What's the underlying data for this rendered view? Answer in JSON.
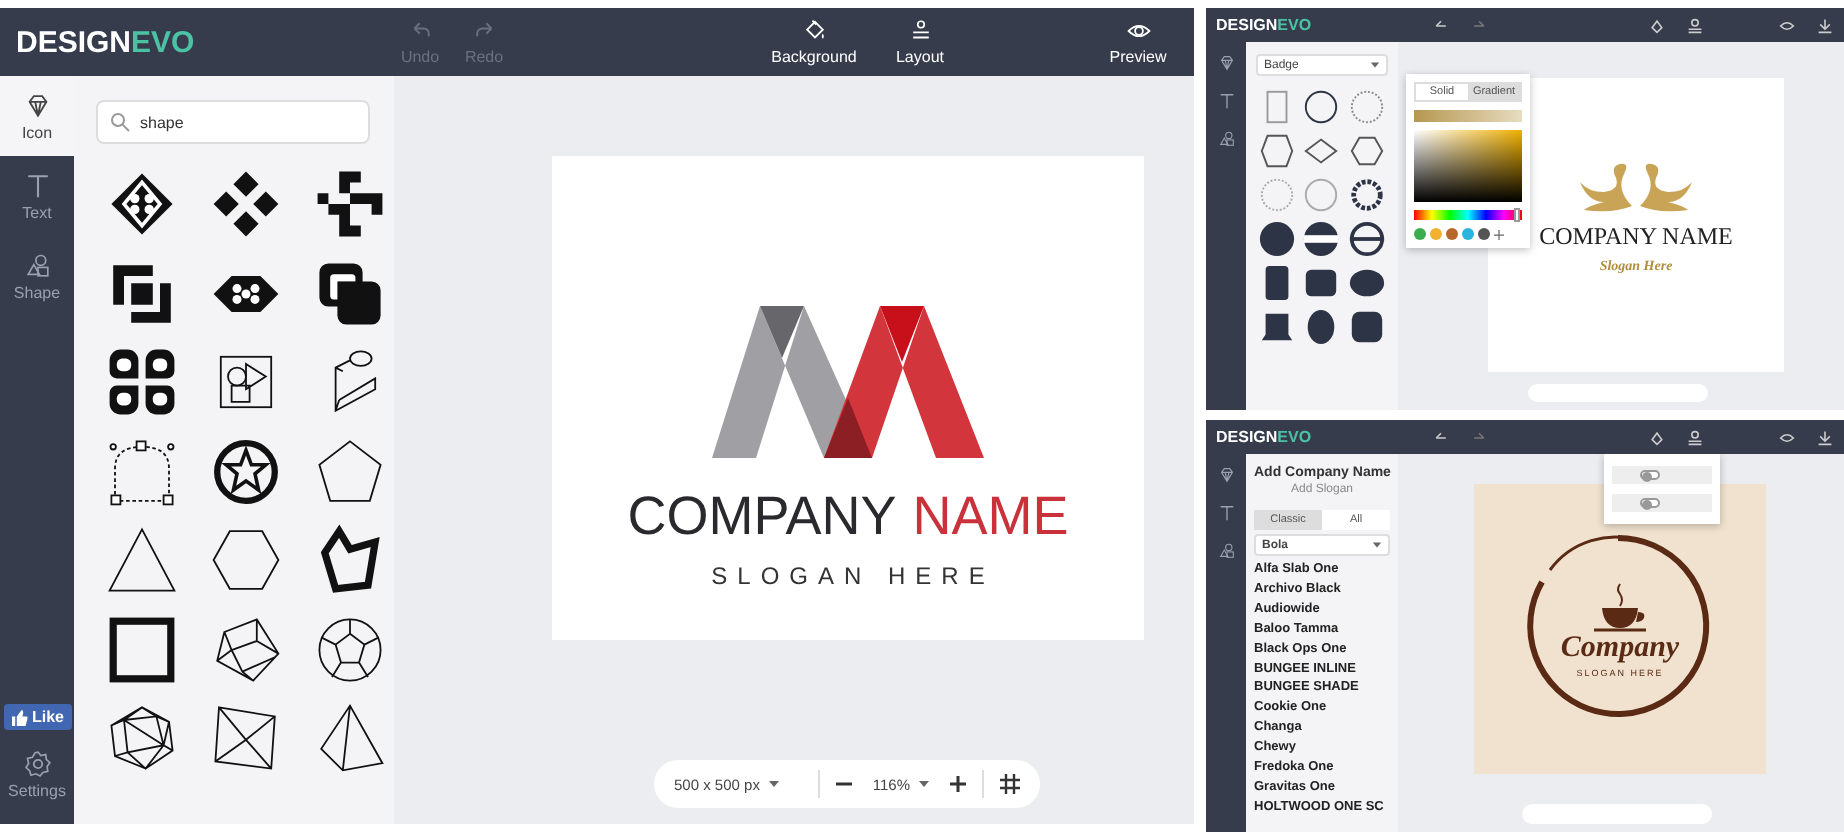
{
  "main": {
    "logo": [
      {
        "text": "DESIGN",
        "color": "#ffffff"
      },
      {
        "text": "EVO",
        "color": "#4cc2a4"
      }
    ],
    "toolbar": [
      {
        "kind": "undo",
        "label": "Undo",
        "disabled": true
      },
      {
        "kind": "redo",
        "label": "Redo",
        "disabled": true
      },
      {
        "kind": "background",
        "label": "Background",
        "disabled": false
      },
      {
        "kind": "layout",
        "label": "Layout",
        "disabled": false
      },
      {
        "kind": "preview",
        "label": "Preview",
        "disabled": false
      }
    ],
    "sidebar": [
      {
        "kind": "icon",
        "label": "Icon",
        "selected": true
      },
      {
        "kind": "text",
        "label": "Text",
        "selected": false
      },
      {
        "kind": "shape",
        "label": "Shape",
        "selected": false
      }
    ],
    "like_button": "Like",
    "settings": "Settings",
    "search": {
      "value": "shape"
    },
    "artboard": {
      "name": [
        {
          "text": "COMPANY",
          "color": "#2a2a2e"
        },
        {
          "text": "NAME",
          "color": "#c9323b"
        }
      ],
      "slogan": "SLOGAN HERE"
    },
    "zoom_bar": {
      "size": "500 x 500 px",
      "zoom": "116%"
    }
  },
  "badge_editor": {
    "logo": [
      {
        "text": "DESIGN",
        "color": "#ffffff"
      },
      {
        "text": "EVO",
        "color": "#4cc2a4"
      }
    ],
    "category": "Badge",
    "color_tabs": [
      {
        "label": "Solid",
        "selected": false
      },
      {
        "label": "Gradient",
        "selected": true
      }
    ],
    "hue": {
      "level": 0.97
    },
    "swatches": [
      {
        "color": "#3aae4e"
      },
      {
        "color": "#f2b230"
      },
      {
        "color": "#b9682c"
      },
      {
        "color": "#29b5de"
      },
      {
        "color": "#555555"
      }
    ],
    "artboard": {
      "name": "COMPANY NAME",
      "slogan": "Slogan Here"
    }
  },
  "text_editor": {
    "logo": [
      {
        "text": "DESIGN",
        "color": "#ffffff"
      },
      {
        "text": "EVO",
        "color": "#4cc2a4"
      }
    ],
    "company_name": "Add Company Name",
    "slogan": "Add Slogan",
    "font_tabs": [
      {
        "label": "Classic",
        "selected": true
      },
      {
        "label": "All",
        "selected": false
      }
    ],
    "font_category": "Bola",
    "fonts": [
      "Alfa Slab One",
      "Archivo Black",
      "Audiowide",
      "Baloo Tamma",
      "Black Ops One",
      "BUNGEE INLINE",
      "BUNGEE SHADE",
      "Cookie One",
      "Changa",
      "Chewy",
      "Fredoka One",
      "Gravitas One",
      "HOLTWOOD ONE SC"
    ],
    "toggles": [
      {
        "on": false
      },
      {
        "on": false
      }
    ],
    "artboard": {
      "name": "Company",
      "slogan": "SLOGAN HERE"
    }
  }
}
